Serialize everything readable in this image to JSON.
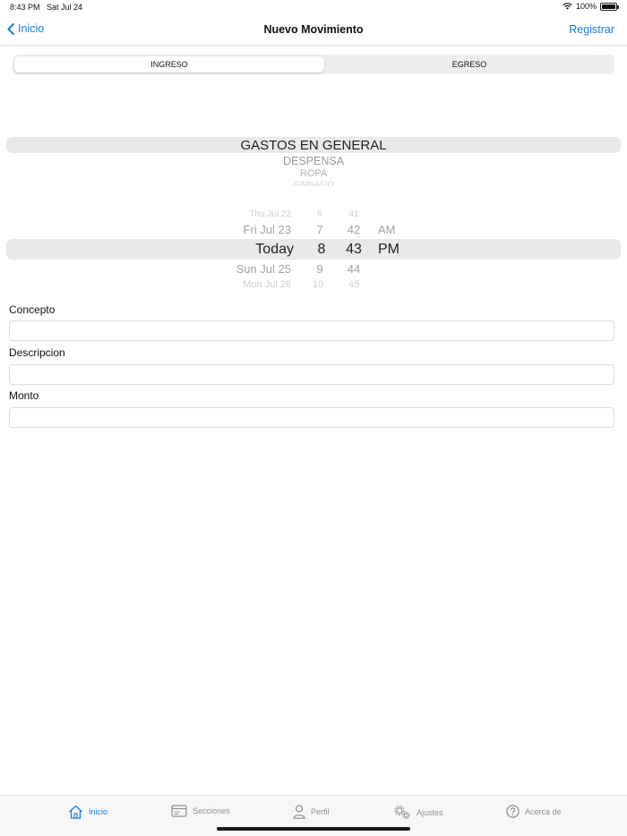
{
  "status_bar": {
    "time": "8:43 PM",
    "date": "Sat Jul 24",
    "battery": "100%"
  },
  "nav": {
    "back_label": "Inicio",
    "title": "Nuevo Movimiento",
    "action_label": "Registrar"
  },
  "segments": {
    "selected": "INGRESO",
    "other": "EGRESO"
  },
  "category_picker": {
    "selected": "GASTOS EN GENERAL",
    "below": [
      "DESPENSA",
      "ROPA",
      "GIMNASIO"
    ]
  },
  "datetime_picker": {
    "rows": [
      {
        "day": "Thu Jul 22",
        "hour": "6",
        "minute": "41",
        "ampm": ""
      },
      {
        "day": "Fri Jul 23",
        "hour": "7",
        "minute": "42",
        "ampm": "AM"
      },
      {
        "day": "Today",
        "hour": "8",
        "minute": "43",
        "ampm": "PM"
      },
      {
        "day": "Sun Jul 25",
        "hour": "9",
        "minute": "44",
        "ampm": ""
      },
      {
        "day": "Mon Jul 26",
        "hour": "10",
        "minute": "45",
        "ampm": ""
      }
    ]
  },
  "form": {
    "concepto_label": "Concepto",
    "concepto_value": "",
    "descripcion_label": "Descripcion",
    "descripcion_value": "",
    "monto_label": "Monto",
    "monto_value": ""
  },
  "tabbar": {
    "items": [
      {
        "label": "Inicio",
        "icon": "home-icon",
        "active": true
      },
      {
        "label": "Secciones",
        "icon": "card-icon",
        "active": false
      },
      {
        "label": "Perfil",
        "icon": "person-icon",
        "active": false
      },
      {
        "label": "Ajustes",
        "icon": "gears-icon",
        "active": false
      },
      {
        "label": "Acerca de",
        "icon": "question-icon",
        "active": false
      }
    ]
  },
  "colors": {
    "accent": "#1a7de0",
    "picker_band": "#e9e9ea",
    "inactive_tab": "#8e8e93"
  }
}
